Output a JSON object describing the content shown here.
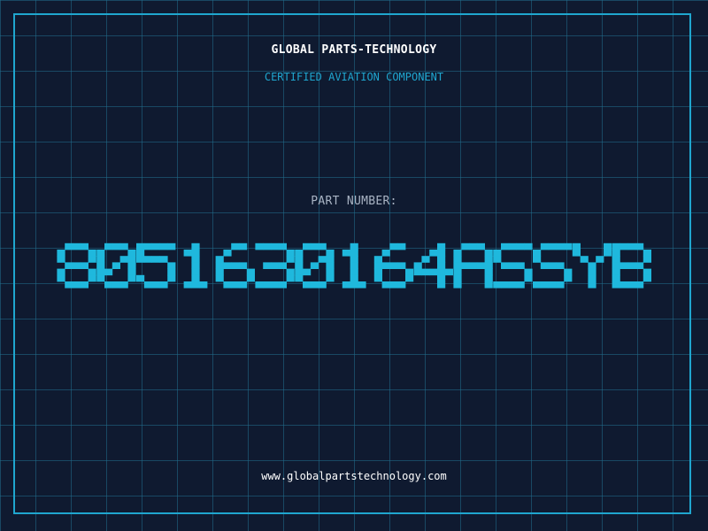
{
  "header": {
    "company": "GLOBAL PARTS-TECHNOLOGY",
    "subtitle": "CERTIFIED AVIATION COMPONENT"
  },
  "part": {
    "label": "PART NUMBER:",
    "number": "8051630164ASSYB"
  },
  "footer": {
    "url": "www.globalpartstechnology.com"
  },
  "colors": {
    "background": "#0f1a30",
    "grid": "#216e8c",
    "accent": "#1fa6cf",
    "part_number": "#1fb8dd",
    "label": "#a9b4c4",
    "text": "#ffffff"
  }
}
